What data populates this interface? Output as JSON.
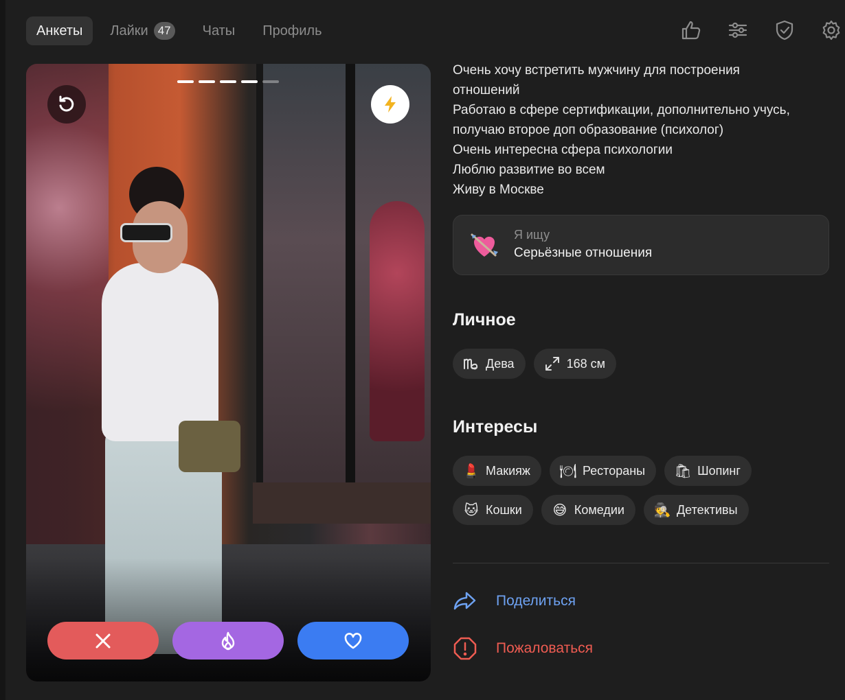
{
  "nav": {
    "tabs": [
      {
        "label": "Анкеты",
        "active": true
      },
      {
        "label": "Лайки",
        "badge": "47"
      },
      {
        "label": "Чаты"
      },
      {
        "label": "Профиль"
      }
    ],
    "icons": [
      "thumbs-up-icon",
      "filters-icon",
      "shield-icon",
      "settings-icon"
    ]
  },
  "card": {
    "photo_count": 5,
    "current_photo": 4,
    "buttons": [
      "undo-icon",
      "lightning-icon",
      "close-icon",
      "fire-icon",
      "heart-icon"
    ],
    "colors": {
      "dislike": "#e35b5b",
      "superlike": "#a467e2",
      "like": "#3b7cf2",
      "boost": "#f2b320"
    }
  },
  "bio": {
    "lines": [
      "Очень хочу встретить мужчину для построения",
      "отношений",
      "Работаю в сфере сертификации, дополнительно учусь,",
      "получаю второе доп образование (психолог)",
      "Очень интересна сфера психологии",
      "Люблю развитие во всем",
      "Живу в Москве"
    ]
  },
  "seeking": {
    "label": "Я ищу",
    "value": "Серьёзные отношения",
    "icon": "heart-arrow-emoji"
  },
  "personal": {
    "title": "Личное",
    "items": [
      {
        "icon": "virgo-icon",
        "label": "Дева"
      },
      {
        "icon": "height-icon",
        "label": "168 см"
      }
    ]
  },
  "interests": {
    "title": "Интересы",
    "items": [
      {
        "emoji": "💄",
        "label": "Макияж"
      },
      {
        "emoji": "🍽",
        "label": "Рестораны"
      },
      {
        "emoji": "🛍",
        "label": "Шопинг"
      },
      {
        "emoji": "🐱",
        "label": "Кошки"
      },
      {
        "emoji": "😅",
        "label": "Комедии"
      },
      {
        "emoji": "🕵",
        "label": "Детективы"
      }
    ]
  },
  "links": {
    "share": "Поделиться",
    "report": "Пожаловаться",
    "share_color": "#6ea2f2",
    "report_color": "#ef5c52"
  }
}
